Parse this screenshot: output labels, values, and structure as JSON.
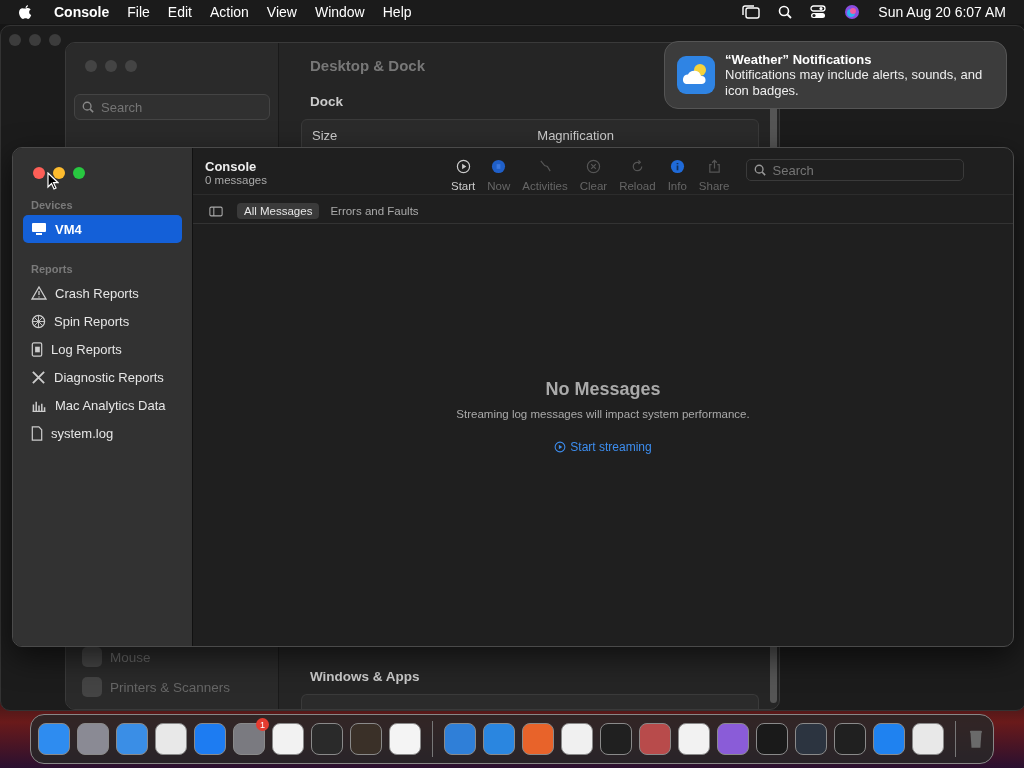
{
  "menu_bar": {
    "app": "Console",
    "menus": [
      "File",
      "Edit",
      "Action",
      "View",
      "Window",
      "Help"
    ],
    "clock": "Sun Aug 20  6:07 AM"
  },
  "notification": {
    "title": "“Weather” Notifications",
    "body": "Notifications may include alerts, sounds, and icon badges."
  },
  "settings_window": {
    "title": "Desktop & Dock",
    "search": {
      "placeholder": "Search"
    },
    "section": "Dock",
    "labels": [
      "Size",
      "Magnification"
    ],
    "sidebar_items": [
      "Mouse",
      "Printers & Scanners"
    ],
    "section_2": "Windows & Apps"
  },
  "console": {
    "title": "Console",
    "subtitle": "0 messages",
    "sidebar": [
      {
        "heading": "Devices",
        "items": [
          {
            "label": "VM4",
            "kind": "display",
            "selected": true
          }
        ]
      },
      {
        "heading": "Reports",
        "items": [
          {
            "label": "Crash Reports",
            "kind": "warning",
            "selected": false
          },
          {
            "label": "Spin Reports",
            "kind": "wheel",
            "selected": false
          },
          {
            "label": "Log Reports",
            "kind": "doc",
            "selected": false
          },
          {
            "label": "Diagnostic Reports",
            "kind": "tools",
            "selected": false
          },
          {
            "label": "Mac Analytics Data",
            "kind": "bars",
            "selected": false
          },
          {
            "label": "system.log",
            "kind": "file",
            "selected": false
          }
        ]
      }
    ],
    "toolbar": [
      {
        "label": "Start",
        "kind": "play",
        "disabled": false
      },
      {
        "label": "Now",
        "kind": "now",
        "disabled": true
      },
      {
        "label": "Activities",
        "kind": "activities",
        "disabled": true
      },
      {
        "label": "Clear",
        "kind": "clear",
        "disabled": true
      },
      {
        "label": "Reload",
        "kind": "reload",
        "disabled": true
      },
      {
        "label": "Info",
        "kind": "info",
        "disabled": true
      },
      {
        "label": "Share",
        "kind": "share",
        "disabled": true
      }
    ],
    "search": {
      "placeholder": "Search"
    },
    "filters": [
      {
        "label": "All Messages",
        "selected": true
      },
      {
        "label": "Errors and Faults",
        "selected": false
      }
    ],
    "empty": {
      "title": "No Messages",
      "text": "Streaming log messages will impact system performance.",
      "link": "Start streaming"
    }
  },
  "dock": {
    "items": [
      {
        "kind": "app",
        "color": "#2e8cf0"
      },
      {
        "kind": "app",
        "color": "#8a8a94"
      },
      {
        "kind": "app",
        "color": "#3a8ee6"
      },
      {
        "kind": "app",
        "color": "#e8e8e8"
      },
      {
        "kind": "app",
        "color": "#1d7cf2"
      },
      {
        "kind": "app",
        "color": "#7a7a80",
        "badge": "1"
      },
      {
        "kind": "app",
        "color": "#f2f2f2"
      },
      {
        "kind": "app",
        "color": "#2a2a2a"
      },
      {
        "kind": "app",
        "color": "#3a3028"
      },
      {
        "kind": "app",
        "color": "#f4f4f4"
      },
      {
        "kind": "separator"
      },
      {
        "kind": "app",
        "color": "#2f7fd8"
      },
      {
        "kind": "app",
        "color": "#2a86e0"
      },
      {
        "kind": "app",
        "color": "#e8632a"
      },
      {
        "kind": "app",
        "color": "#f0f0f0"
      },
      {
        "kind": "app",
        "color": "#202020"
      },
      {
        "kind": "app",
        "color": "#b84b4b"
      },
      {
        "kind": "app",
        "color": "#f2f2f2"
      },
      {
        "kind": "app",
        "color": "#8a5cd8"
      },
      {
        "kind": "app",
        "color": "#1a1a1a"
      },
      {
        "kind": "app",
        "color": "#2c3440"
      },
      {
        "kind": "app",
        "color": "#202020"
      },
      {
        "kind": "app",
        "color": "#1f82f0"
      },
      {
        "kind": "app",
        "color": "#e8e8e8"
      },
      {
        "kind": "separator"
      },
      {
        "kind": "trash",
        "color": "#6a6a6a"
      }
    ]
  }
}
